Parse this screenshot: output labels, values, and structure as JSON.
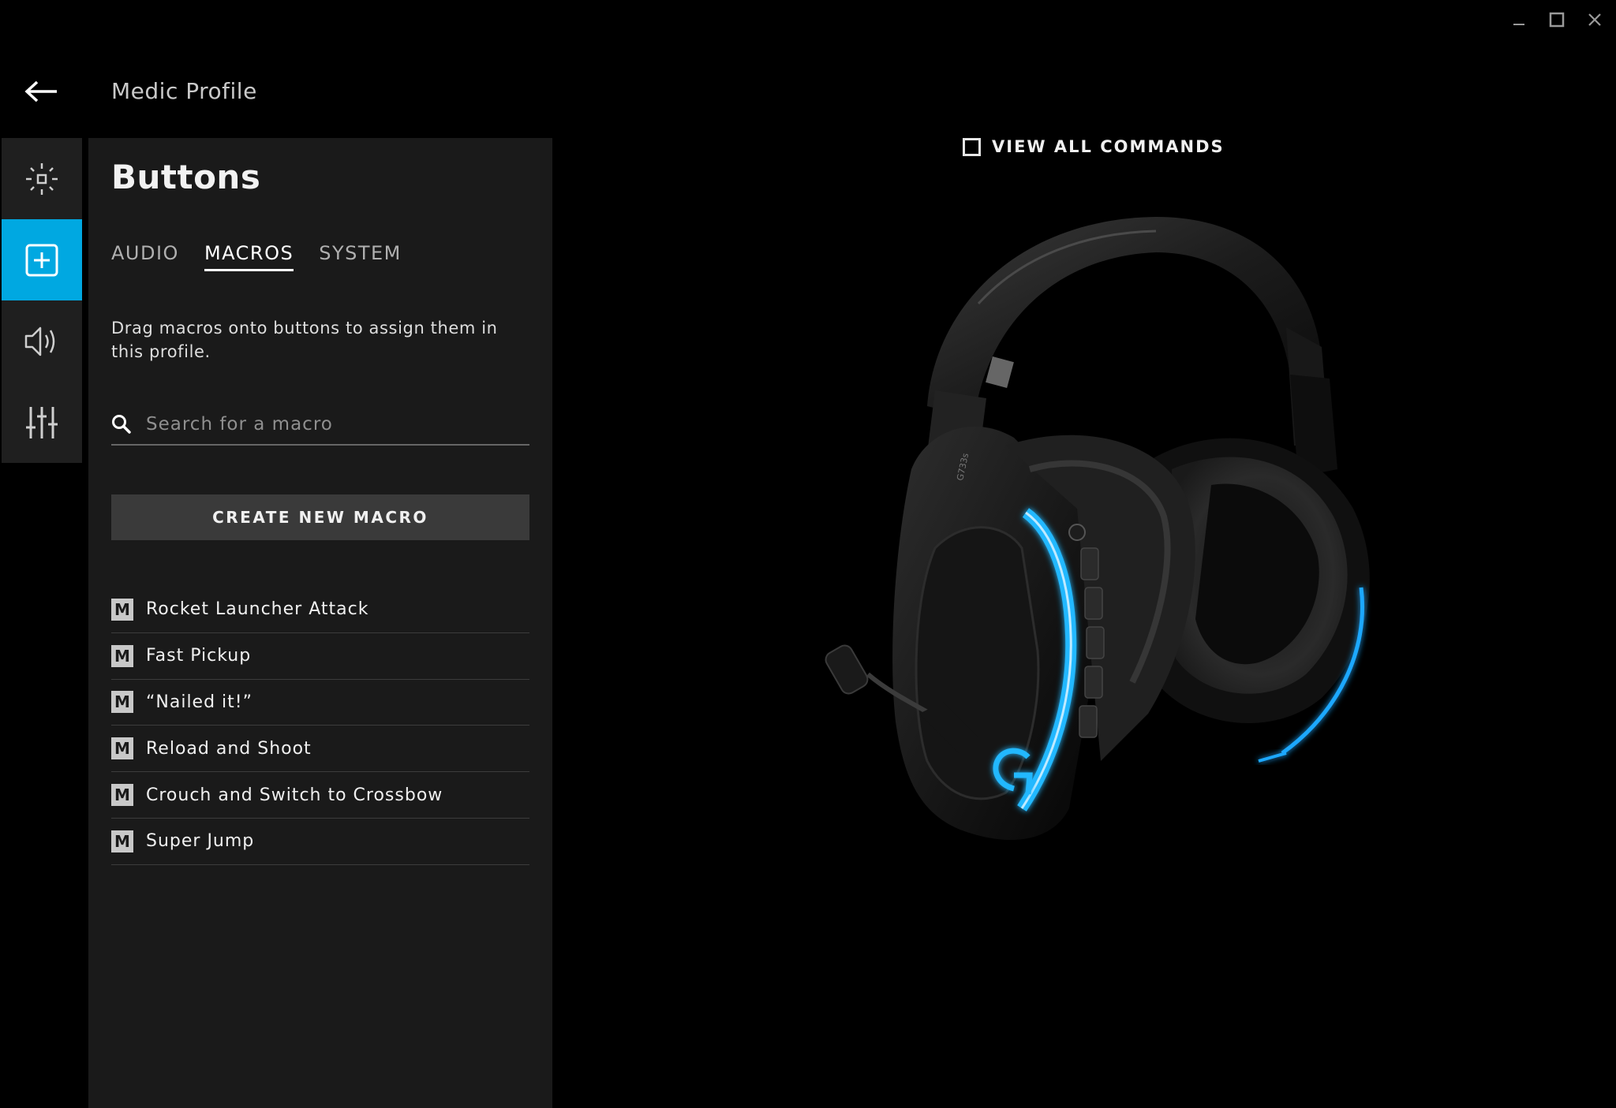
{
  "window": {
    "controls": [
      "minimize-icon",
      "maximize-icon",
      "close-icon"
    ]
  },
  "header": {
    "back_icon": "arrow-left-icon",
    "profile_title": "Medic Profile"
  },
  "rail": {
    "items": [
      {
        "icon": "lighting-sun-icon",
        "active": false
      },
      {
        "icon": "plus-square-icon",
        "active": true
      },
      {
        "icon": "speaker-icon",
        "active": false
      },
      {
        "icon": "equalizer-sliders-icon",
        "active": false
      }
    ]
  },
  "panel": {
    "title": "Buttons",
    "tabs": [
      {
        "label": "AUDIO",
        "active": false
      },
      {
        "label": "MACROS",
        "active": true
      },
      {
        "label": "SYSTEM",
        "active": false
      }
    ],
    "description": "Drag macros onto buttons to assign them in this profile.",
    "search": {
      "placeholder": "Search for a macro",
      "value": ""
    },
    "create_button": "CREATE NEW MACRO",
    "macros": [
      {
        "badge": "M",
        "label": "Rocket Launcher Attack"
      },
      {
        "badge": "M",
        "label": "Fast Pickup"
      },
      {
        "badge": "M",
        "label": "“Nailed it!”"
      },
      {
        "badge": "M",
        "label": "Reload and Shoot"
      },
      {
        "badge": "M",
        "label": "Crouch and Switch to Crossbow"
      },
      {
        "badge": "M",
        "label": "Super Jump"
      }
    ]
  },
  "device_view": {
    "view_all_label": "VIEW ALL COMMANDS",
    "view_all_checked": false,
    "device_model_text": "G733s"
  },
  "colors": {
    "accent": "#00a8e1",
    "background": "#000000",
    "panel": "#1a1a1a",
    "rail": "#1f1f1f"
  }
}
